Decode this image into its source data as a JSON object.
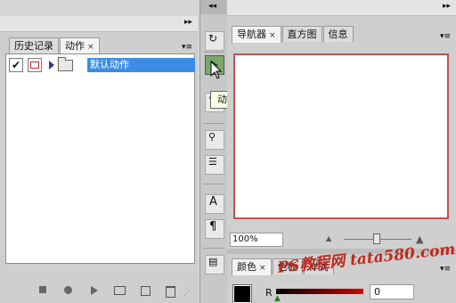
{
  "left_panel": {
    "tabs": [
      {
        "label": "历史记录",
        "active": false
      },
      {
        "label": "动作",
        "active": true,
        "close": "×"
      }
    ],
    "actions": [
      {
        "checked": "✔",
        "label": "默认动作"
      }
    ],
    "footer_icons": [
      "stop-icon",
      "record-icon",
      "play-icon",
      "new-set-icon",
      "new-action-icon",
      "delete-icon"
    ]
  },
  "tooltip": "动作",
  "right_panel": {
    "tabs": [
      {
        "label": "导航器",
        "active": true,
        "close": "×"
      },
      {
        "label": "直方图",
        "active": false
      },
      {
        "label": "信息",
        "active": false
      }
    ],
    "zoom": "100%",
    "color_tabs": [
      {
        "label": "颜色",
        "active": true,
        "close": "×"
      },
      {
        "label": "色板",
        "active": false
      },
      {
        "label": "样式",
        "active": false
      }
    ],
    "channel_label": "R",
    "channel_value": "0"
  },
  "watermark": "PS教程网 tata580.com",
  "colors": {
    "accent": "#3a8ee8",
    "navigator_border": "#c05050",
    "watermark": "#c2281e"
  }
}
